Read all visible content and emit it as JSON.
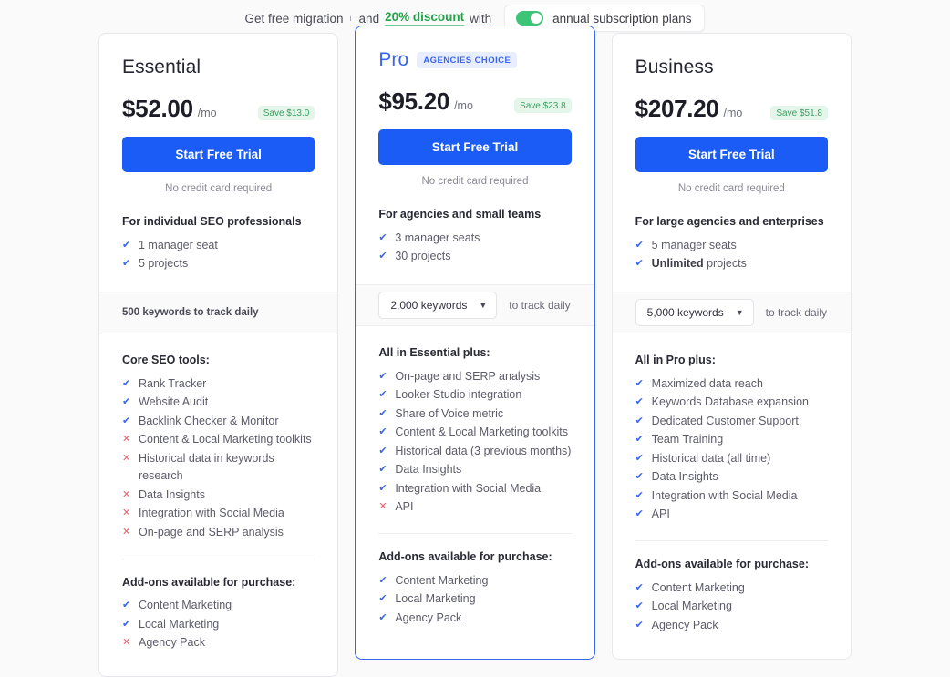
{
  "promo": {
    "lead": "Get free migration",
    "superscript": "i",
    "conjunction": "and",
    "discount": "20% discount",
    "with": "with",
    "toggle_label": "annual subscription plans",
    "toggle_state": "on",
    "accent_green": "#24a148",
    "toggle_green": "#3ec477"
  },
  "common": {
    "cta_label": "Start Free Trial",
    "no_card_note": "No credit card required",
    "addons_title": "Add-ons available for purchase:",
    "kw_suffix": "to track daily",
    "accent_blue": "#3866f0",
    "cta_blue": "#1a5cf5",
    "yes_color": "#3866f0",
    "no_color": "#ef5e6b",
    "save_color": "#3f9e62"
  },
  "plans": [
    {
      "name": "Essential",
      "badge": null,
      "price": "$52.00",
      "period": "/mo",
      "save": "Save $13.0",
      "audience": "For individual SEO professionals",
      "seats": [
        {
          "mark": "yes",
          "label": "1 manager seat"
        },
        {
          "mark": "yes",
          "label": "5 projects"
        }
      ],
      "keywords_type": "static",
      "keywords_text": "500 keywords to track daily",
      "keywords_value": "500 keywords",
      "features_title": "Core SEO tools:",
      "features": [
        {
          "mark": "yes",
          "label": "Rank Tracker"
        },
        {
          "mark": "yes",
          "label": "Website Audit"
        },
        {
          "mark": "yes",
          "label": "Backlink Checker & Monitor"
        },
        {
          "mark": "no",
          "label": "Content & Local Marketing toolkits"
        },
        {
          "mark": "no",
          "label": "Historical data in keywords research"
        },
        {
          "mark": "no",
          "label": "Data Insights"
        },
        {
          "mark": "no",
          "label": "Integration with Social Media"
        },
        {
          "mark": "no",
          "label": "On-page and SERP analysis"
        }
      ],
      "addons": [
        {
          "mark": "yes",
          "label": "Content Marketing"
        },
        {
          "mark": "yes",
          "label": "Local Marketing"
        },
        {
          "mark": "no",
          "label": "Agency Pack"
        }
      ]
    },
    {
      "name": "Pro",
      "badge": "AGENCIES CHOICE",
      "price": "$95.20",
      "period": "/mo",
      "save": "Save $23.8",
      "audience": "For agencies and small teams",
      "seats": [
        {
          "mark": "yes",
          "label": "3 manager seats"
        },
        {
          "mark": "yes",
          "label": "30 projects"
        }
      ],
      "keywords_type": "select",
      "keywords_text": "2,000 keywords to track daily",
      "keywords_value": "2,000 keywords",
      "features_title": "All in Essential plus:",
      "features": [
        {
          "mark": "yes",
          "label": "On-page and SERP analysis"
        },
        {
          "mark": "yes",
          "label": "Looker Studio integration"
        },
        {
          "mark": "yes",
          "label": "Share of Voice metric"
        },
        {
          "mark": "yes",
          "label": "Content & Local Marketing toolkits"
        },
        {
          "mark": "yes",
          "label": "Historical data (3 previous months)"
        },
        {
          "mark": "yes",
          "label": "Data Insights"
        },
        {
          "mark": "yes",
          "label": "Integration with Social Media"
        },
        {
          "mark": "no",
          "label": "API"
        }
      ],
      "addons": [
        {
          "mark": "yes",
          "label": "Content Marketing"
        },
        {
          "mark": "yes",
          "label": "Local Marketing"
        },
        {
          "mark": "yes",
          "label": "Agency Pack"
        }
      ]
    },
    {
      "name": "Business",
      "badge": null,
      "price": "$207.20",
      "period": "/mo",
      "save": "Save $51.8",
      "audience": "For large agencies and enterprises",
      "seats": [
        {
          "mark": "yes",
          "label": "5 manager seats"
        },
        {
          "mark": "yes",
          "label": "Unlimited projects",
          "bold_prefix": "Unlimited"
        }
      ],
      "keywords_type": "select",
      "keywords_text": "5,000 keywords to track daily",
      "keywords_value": "5,000 keywords",
      "features_title": "All in Pro plus:",
      "features": [
        {
          "mark": "yes",
          "label": "Maximized data reach"
        },
        {
          "mark": "yes",
          "label": "Keywords Database expansion"
        },
        {
          "mark": "yes",
          "label": "Dedicated Customer Support"
        },
        {
          "mark": "yes",
          "label": "Team Training"
        },
        {
          "mark": "yes",
          "label": "Historical data (all time)"
        },
        {
          "mark": "yes",
          "label": "Data Insights"
        },
        {
          "mark": "yes",
          "label": "Integration with Social Media"
        },
        {
          "mark": "yes",
          "label": "API"
        }
      ],
      "addons": [
        {
          "mark": "yes",
          "label": "Content Marketing"
        },
        {
          "mark": "yes",
          "label": "Local Marketing"
        },
        {
          "mark": "yes",
          "label": "Agency Pack"
        }
      ]
    }
  ]
}
